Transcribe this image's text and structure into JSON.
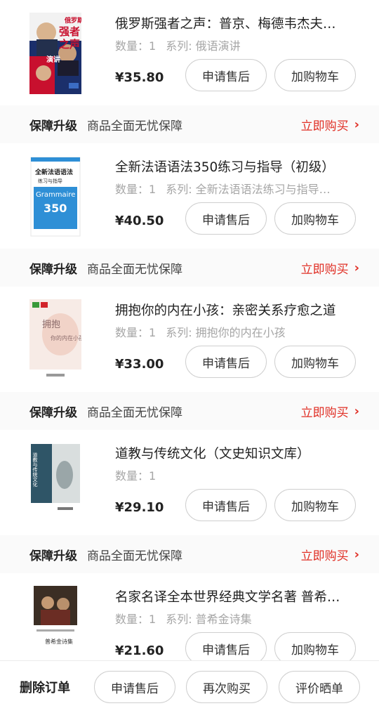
{
  "products": [
    {
      "title": "俄罗斯强者之声：普京、梅德韦杰夫…",
      "quantity_label": "数量：1",
      "series_label": "系列: 俄语演讲",
      "price": "¥35.80",
      "cover_icon": "book-cover-russian-speeches",
      "cover_text": [
        "俄罗斯",
        "强者",
        "之声",
        "演讲"
      ]
    },
    {
      "title": "全新法语语法350练习与指导（初级）",
      "quantity_label": "数量：1",
      "series_label": "系列: 全新法语语法练习与指导…",
      "price": "¥40.50",
      "cover_icon": "book-cover-french-grammar",
      "cover_text": [
        "全新法语语法",
        "练习与指导",
        "Grammaire",
        "350"
      ]
    },
    {
      "title": "拥抱你的内在小孩：亲密关系疗愈之道",
      "quantity_label": "数量：1",
      "series_label": "系列: 拥抱你的内在小孩",
      "price": "¥33.00",
      "cover_icon": "book-cover-inner-child",
      "cover_text": [
        "拥抱",
        "你的内在小孩"
      ]
    },
    {
      "title": "道教与传统文化（文史知识文库）",
      "quantity_label": "数量：1",
      "series_label": "",
      "price": "¥29.10",
      "cover_icon": "book-cover-taoism",
      "cover_text": [
        "道教与传统文化"
      ]
    },
    {
      "title": "名家名译全本世界经典文学名著 普希…",
      "quantity_label": "数量：1",
      "series_label": "系列: 普希金诗集",
      "price": "¥21.60",
      "cover_icon": "book-cover-pushkin",
      "cover_text": [
        "普希金诗集"
      ]
    }
  ],
  "actions": {
    "after_sales": "申请售后",
    "add_to_cart": "加购物车"
  },
  "guarantee": {
    "title": "保障升级",
    "desc": "商品全面无忧保障",
    "buy_now": "立即购买",
    "chevron": "›"
  },
  "bottom_bar": {
    "delete_order": "删除订单",
    "after_sales": "申请售后",
    "buy_again": "再次购买",
    "review": "评价晒单"
  },
  "colors": {
    "accent": "#e02e24",
    "muted_text": "#a6a6a6",
    "guarantee_bg": "#fafafa"
  }
}
